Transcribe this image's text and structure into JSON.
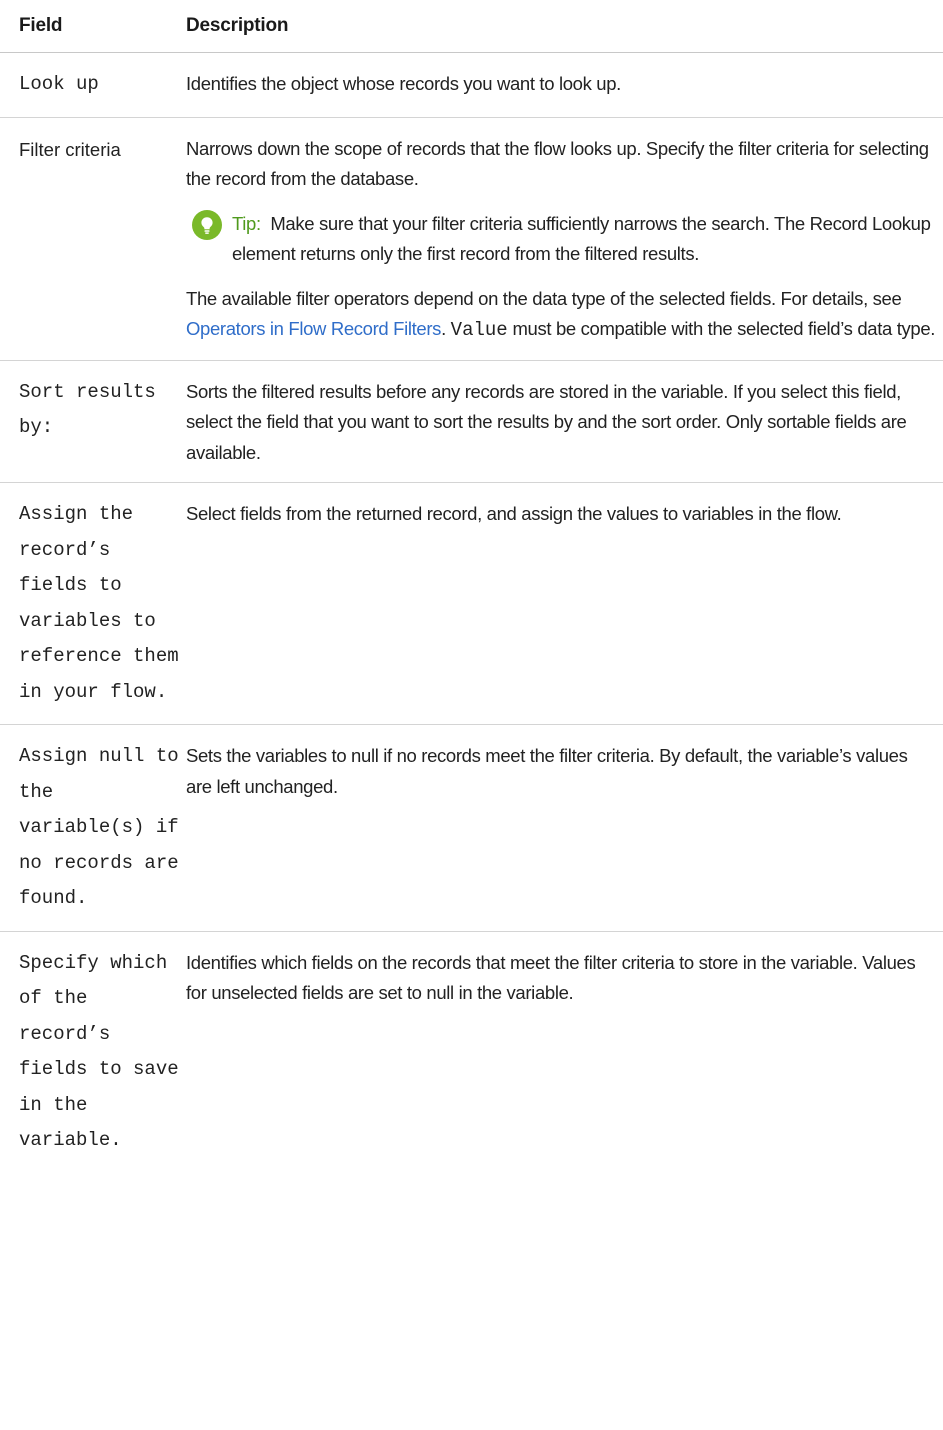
{
  "header": {
    "field": "Field",
    "description": "Description"
  },
  "rows": [
    {
      "field": "Look up",
      "description": "Identifies the object whose records you want to look up."
    },
    {
      "field": "Filter criteria",
      "description": "Narrows down the scope of records that the flow looks up. Specify the filter criteria for selecting the record from the database.",
      "tip_label": "Tip:",
      "tip_text": "Make sure that your filter criteria sufficiently narrows the search. The Record Lookup element returns only the first record from the filtered results.",
      "note_before_link": "The available filter operators depend on the data type of the selected fields. For details, see ",
      "link_text": "Operators in Flow Record Filters",
      "note_after_link": ". ",
      "inline_code": "Value",
      "note_end": " must be compatible with the selected field’s data type."
    },
    {
      "field": "Sort results by:",
      "description": "Sorts the filtered results before any records are stored in the variable. If you select this field, select the field that you want to sort the results by and the sort order. Only sortable fields are available."
    },
    {
      "field": "Assign the record’s fields to variables to reference them in your flow.",
      "description": "Select fields from the returned record, and assign the values to variables in the flow."
    },
    {
      "field": "Assign null to the variable(s) if no records are found.",
      "description": "Sets the variables to null if no records meet the filter criteria. By default, the variable’s values are left unchanged."
    },
    {
      "field": "Specify which of the record’s fields to save in the variable.",
      "description": "Identifies which fields on the records that meet the filter criteria to store in the variable. Values for unselected fields are set to null in the variable."
    }
  ],
  "colors": {
    "tip_icon": "#7ab929",
    "tip_label": "#4f9a1d",
    "link": "#2f6dc9",
    "rule": "#d4d4d4"
  },
  "icons": {
    "tip": "lightbulb-icon"
  }
}
